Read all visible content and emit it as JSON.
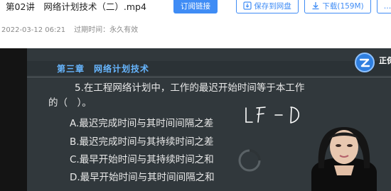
{
  "file": {
    "title": "第02讲　网络计划技术（二）.mp4",
    "date": "2022-03-12 06:21",
    "expire": "过期时间：永久有效"
  },
  "toolbar": {
    "subscribe_label": "订阅链接",
    "save_label": "保存到网盘",
    "download_label": "下载(159M)",
    "more_label": "…"
  },
  "slide": {
    "chapter": "第三章　网络计划技术",
    "logo_text": "正保",
    "question_line1": "5.在工程网络计划中，工作的最迟开始时间等于本工作",
    "question_line2": "的（　）。",
    "options": [
      "A.最迟完成时间与其时间间隔之差",
      "B.最迟完成时间与其持续时间之差",
      "C.最早开始时间与其持续时间之和",
      "D.最早开始时间与其时间间隔之和"
    ],
    "handwriting": "LF - D"
  },
  "colors": {
    "accent": "#3f8cf5",
    "slide_bg": "#31383c",
    "chapter_text": "#67b6ff",
    "handwriting": "#ffffff"
  },
  "icons": {
    "save": "save-to-disk-icon",
    "download": "download-icon",
    "logo": "brand-logo-icon",
    "loading": "loading-spinner-icon"
  }
}
